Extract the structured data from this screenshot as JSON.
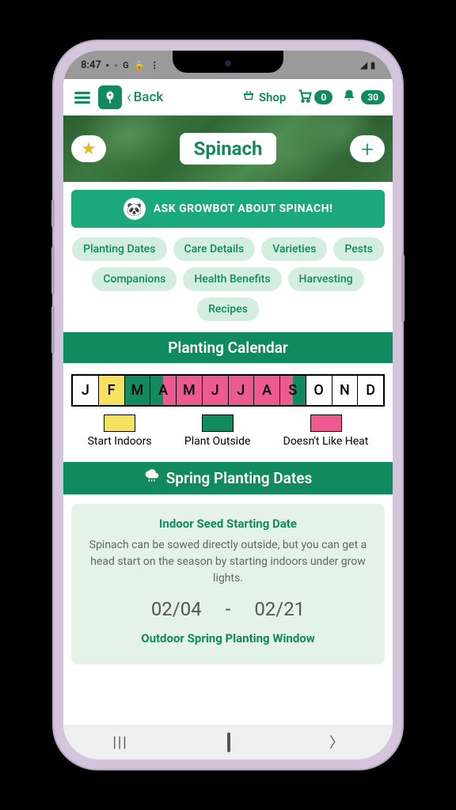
{
  "status": {
    "time": "8:47",
    "icons_left": [
      "teams",
      "battery",
      "G",
      "lock",
      "more"
    ],
    "icons_right": [
      "wifi",
      "signal",
      "battery"
    ]
  },
  "header": {
    "back_label": "Back",
    "shop_label": "Shop",
    "cart_count": "0",
    "notif_count": "30"
  },
  "hero": {
    "title": "Spinach"
  },
  "growbot": {
    "label": "ASK GROWBOT ABOUT SPINACH!"
  },
  "chips": [
    "Planting Dates",
    "Care Details",
    "Varieties",
    "Pests",
    "Companions",
    "Health Benefits",
    "Harvesting",
    "Recipes"
  ],
  "calendar": {
    "title": "Planting Calendar",
    "months": [
      {
        "label": "J",
        "type": "white"
      },
      {
        "label": "F",
        "type": "yellow"
      },
      {
        "label": "M",
        "type": "green"
      },
      {
        "label": "A",
        "type": "split-gp"
      },
      {
        "label": "M",
        "type": "pink"
      },
      {
        "label": "J",
        "type": "pink"
      },
      {
        "label": "J",
        "type": "pink"
      },
      {
        "label": "A",
        "type": "pink"
      },
      {
        "label": "S",
        "type": "split-pg"
      },
      {
        "label": "O",
        "type": "white"
      },
      {
        "label": "N",
        "type": "white"
      },
      {
        "label": "D",
        "type": "white"
      }
    ],
    "legend": [
      {
        "label": "Start Indoors",
        "color": "#f5e060"
      },
      {
        "label": "Plant Outside",
        "color": "#118a5f"
      },
      {
        "label": "Doesn't Like Heat",
        "color": "#ec5a8f"
      }
    ]
  },
  "spring": {
    "title": "Spring Planting Dates",
    "indoor_title": "Indoor Seed Starting Date",
    "indoor_text": "Spinach can be sowed directly outside, but you can get a head start on the season by starting indoors under grow lights.",
    "date_start": "02/04",
    "date_sep": "-",
    "date_end": "02/21",
    "outdoor_title": "Outdoor Spring Planting Window"
  }
}
